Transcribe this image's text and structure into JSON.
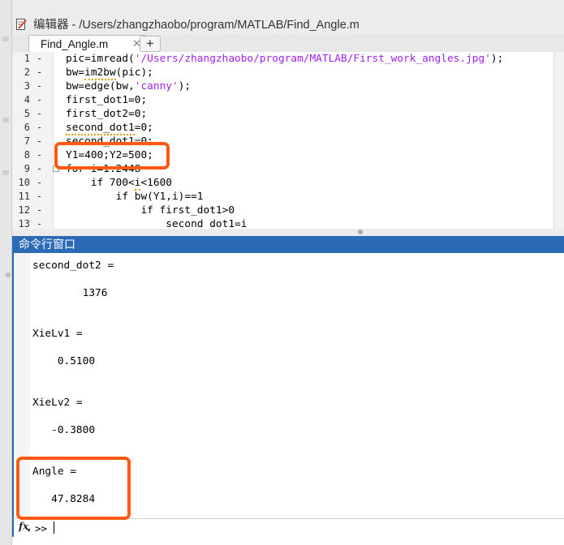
{
  "editor": {
    "title": "编辑器 - /Users/zhangzhaobo/program/MATLAB/Find_Angle.m",
    "tab": {
      "label": "Find_Angle.m",
      "close_glyph": "✕"
    },
    "add_tab_glyph": "+",
    "lines": [
      {
        "num": "1",
        "dash": "-",
        "parts": [
          {
            "t": "pic=imread("
          },
          {
            "t": "'/Users/zhangzhaobo/program/MATLAB/First_work_angles.jpg'",
            "cls": "str"
          },
          {
            "t": ");"
          }
        ]
      },
      {
        "num": "2",
        "dash": "-",
        "parts": [
          {
            "t": "bw="
          },
          {
            "t": "im2bw",
            "cls": "warn"
          },
          {
            "t": "(pic);"
          }
        ]
      },
      {
        "num": "3",
        "dash": "-",
        "parts": [
          {
            "t": "bw=edge(bw,"
          },
          {
            "t": "'canny'",
            "cls": "str"
          },
          {
            "t": ");"
          }
        ]
      },
      {
        "num": "4",
        "dash": "-",
        "parts": [
          {
            "t": "first_dot1=0;"
          }
        ]
      },
      {
        "num": "5",
        "dash": "-",
        "parts": [
          {
            "t": "first_dot2=0;"
          }
        ]
      },
      {
        "num": "6",
        "dash": "-",
        "parts": [
          {
            "t": "second_dot1",
            "cls": "warn"
          },
          {
            "t": "=0;"
          }
        ]
      },
      {
        "num": "7",
        "dash": "-",
        "parts": [
          {
            "t": "second_dot1=0;"
          }
        ]
      },
      {
        "num": "8",
        "dash": "-",
        "parts": [
          {
            "t": "Y1=400;Y2=500;"
          }
        ]
      },
      {
        "num": "9",
        "dash": "-",
        "parts": [
          {
            "t": "for i=1:2448"
          }
        ]
      },
      {
        "num": "10",
        "dash": "-",
        "parts": [
          {
            "t": "    if 700<"
          },
          {
            "t": "i",
            "cls": "warn"
          },
          {
            "t": "<1600"
          }
        ]
      },
      {
        "num": "11",
        "dash": "-",
        "parts": [
          {
            "t": "        if bw(Y1,i)==1"
          }
        ]
      },
      {
        "num": "12",
        "dash": "-",
        "parts": [
          {
            "t": "            if first_dot1>0"
          }
        ]
      },
      {
        "num": "13",
        "dash": "-",
        "parts": [
          {
            "t": "                second_dot1=i"
          }
        ]
      }
    ]
  },
  "command_window": {
    "title": "命令行窗口",
    "output": [
      "second_dot2 =",
      "        1376",
      "XieLv1 =",
      "    0.5100",
      "XieLv2 =",
      "   -0.3800",
      "Angle =",
      "   47.8284"
    ],
    "fx_label": "fx",
    "prompt": ">>"
  },
  "colors": {
    "highlight": "#ff5a14",
    "command_title_bg": "#2b6bb5",
    "string_color": "#a020f0"
  }
}
